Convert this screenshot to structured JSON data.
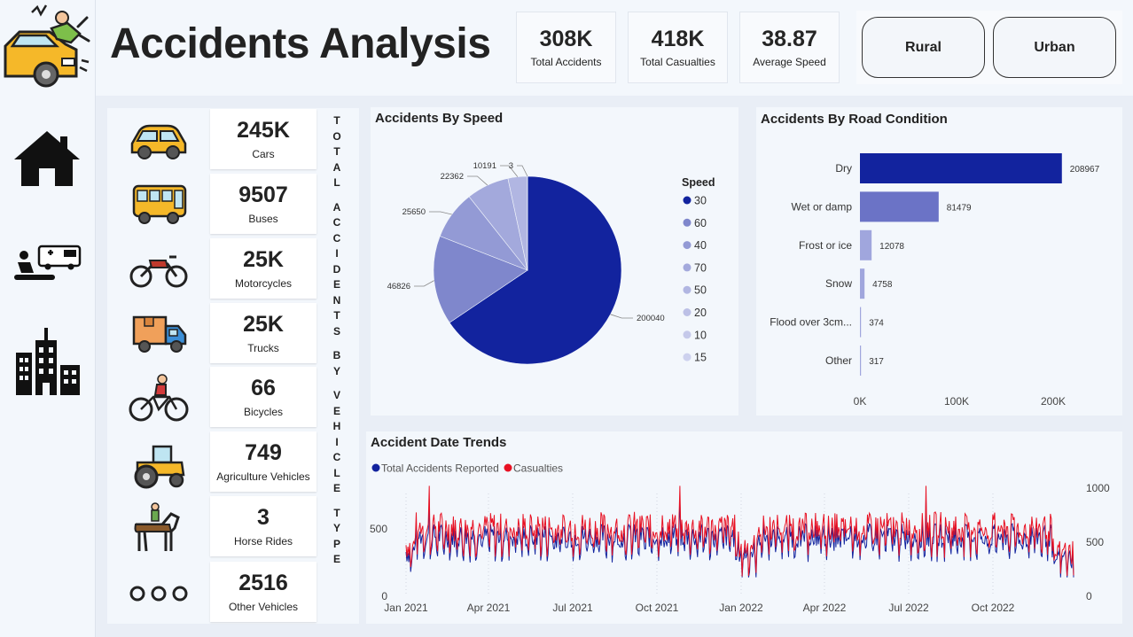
{
  "header": {
    "title": "Accidents Analysis"
  },
  "kpis": [
    {
      "value": "308K",
      "label": "Total Accidents"
    },
    {
      "value": "418K",
      "label": "Total Casualties"
    },
    {
      "value": "38.87",
      "label": "Average Speed"
    }
  ],
  "filters": {
    "rural": "Rural",
    "urban": "Urban"
  },
  "sidebar": {
    "items": [
      {
        "icon": "home-icon"
      },
      {
        "icon": "first-aid-icon"
      },
      {
        "icon": "city-icon"
      }
    ]
  },
  "vehicles": [
    {
      "value": "245K",
      "label": "Cars",
      "icon": "car-icon"
    },
    {
      "value": "9507",
      "label": "Buses",
      "icon": "bus-icon"
    },
    {
      "value": "25K",
      "label": "Motorcycles",
      "icon": "motorcycle-icon"
    },
    {
      "value": "25K",
      "label": "Trucks",
      "icon": "truck-icon"
    },
    {
      "value": "66",
      "label": "Bicycles",
      "icon": "bicycle-icon"
    },
    {
      "value": "749",
      "label": "Agriculture Vehicles",
      "icon": "tractor-icon"
    },
    {
      "value": "3",
      "label": "Horse Rides",
      "icon": "horse-icon"
    },
    {
      "value": "2516",
      "label": "Other Vehicles",
      "icon": "three-circles-icon"
    }
  ],
  "vehicle_caption": "TOTAL ACCIDENTS BY VEHICLE TYPE",
  "colors": {
    "navy": "#12239e",
    "red": "#e81123",
    "bar_mid": "#6b73c6",
    "bar_light": "#a0a6dd"
  },
  "chart_data": [
    {
      "type": "pie",
      "title": "Accidents By Speed",
      "legend_title": "Speed",
      "legend_position": "right",
      "categories": [
        "30",
        "60",
        "40",
        "70",
        "50",
        "20",
        "10",
        "15"
      ],
      "values": [
        200040,
        46826,
        25650,
        22362,
        10191,
        3,
        0,
        0
      ],
      "data_labels": [
        "200040",
        "46826",
        "25650",
        "22362",
        "10191",
        "3"
      ]
    },
    {
      "type": "bar",
      "orientation": "horizontal",
      "title": "Accidents By Road Condition",
      "categories": [
        "Dry",
        "Wet or damp",
        "Frost or ice",
        "Snow",
        "Flood over 3cm...",
        "Other"
      ],
      "values": [
        208967,
        81479,
        12078,
        4758,
        374,
        317
      ],
      "xticks": [
        "0K",
        "100K",
        "200K"
      ],
      "xlim": [
        0,
        230000
      ]
    },
    {
      "type": "line",
      "title": "Accident Date Trends",
      "legend_position": "top-left",
      "series": [
        {
          "name": "Total Accidents Reported",
          "color": "#12239e"
        },
        {
          "name": "Casualties",
          "color": "#e81123"
        }
      ],
      "x_range": [
        "2021-01-01",
        "2022-12-31"
      ],
      "xticks": [
        "Jan 2021",
        "Apr 2021",
        "Jul 2021",
        "Oct 2021",
        "Jan 2022",
        "Apr 2022",
        "Jul 2022",
        "Oct 2022"
      ],
      "yticks_left": [
        "0",
        "500"
      ],
      "yticks_right": [
        "0",
        "500",
        "1000"
      ],
      "approximate_levels": {
        "typical_accidents": 420,
        "typical_casualties": 500,
        "max_casualties": 820,
        "min": 140
      }
    }
  ]
}
